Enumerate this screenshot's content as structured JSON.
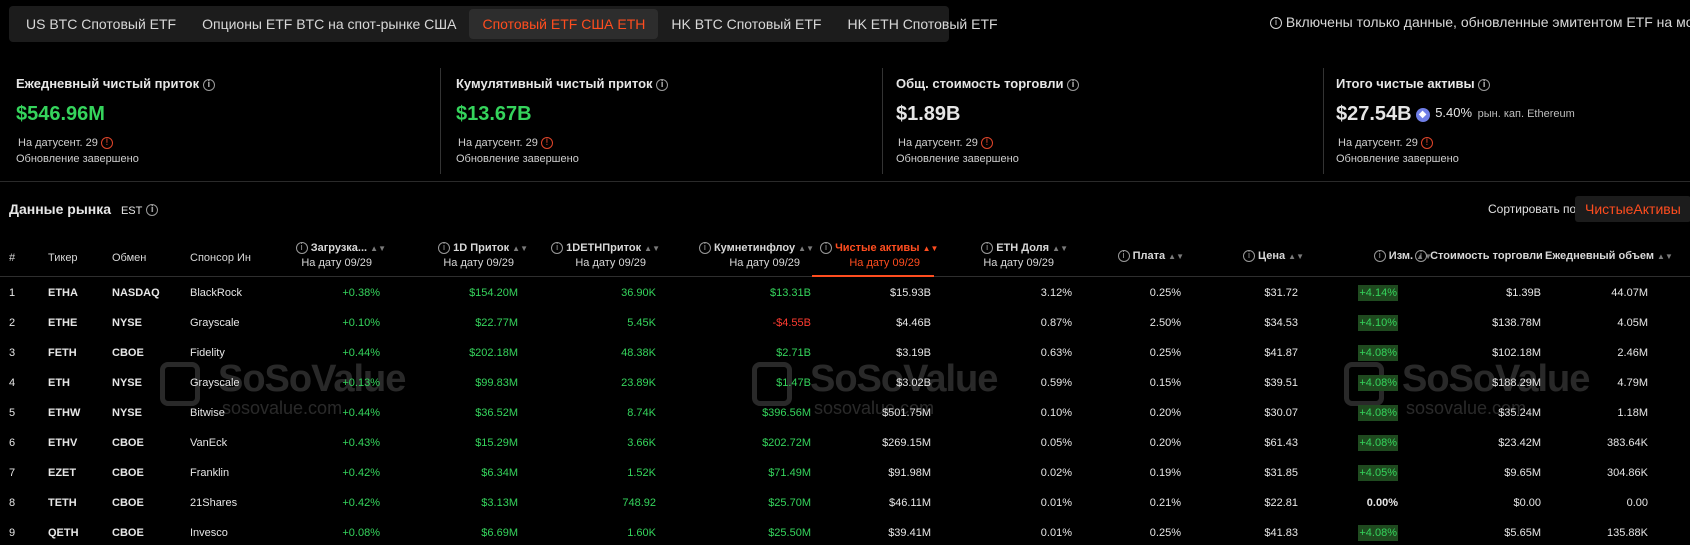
{
  "tabs": [
    {
      "label": "US BTC Спотовый ETF",
      "active": false
    },
    {
      "label": "Опционы ETF BTC на спот-рынке США",
      "active": false
    },
    {
      "label": "Спотовый ETF США ETH",
      "active": true
    },
    {
      "label": "HK BTC Спотовый ETF",
      "active": false
    },
    {
      "label": "HK ETH Спотовый ETF",
      "active": false
    }
  ],
  "notice": "Включены только данные, обновленные эмитентом ETF на момент",
  "cards": [
    {
      "label": "Ежедневный чистый приток",
      "value": "$546.96M",
      "date": "На датусент. 29",
      "status": "Обновление завершено"
    },
    {
      "label": "Кумулятивный чистый приток",
      "value": "$13.67B",
      "date": "На датусент. 29",
      "status": "Обновление завершено"
    },
    {
      "label": "Общ. стоимость торговли",
      "value": "$1.89B",
      "date": "На датусент. 29",
      "status": "Обновление завершено"
    },
    {
      "label": "Итого чистые активы",
      "value": "$27.54B",
      "pct": "5.40%",
      "sub": "рын. кап. Ethereum",
      "date": "На датусент. 29",
      "status": "Обновление завершено"
    }
  ],
  "market": {
    "title": "Данные рынка",
    "tz": "EST",
    "sort_label": "Сортировать по",
    "sort_value": "ЧистыеАктивы"
  },
  "headers": {
    "num": "#",
    "ticker": "Тикер",
    "exchange": "Обмен",
    "sponsor": "Спонсор Ин",
    "premium": {
      "l1": "Загрузка...",
      "l2": "На дату 09/29"
    },
    "inflow": {
      "l1": "1D Приток",
      "l2": "На дату 09/29"
    },
    "eth_inflow": {
      "l1": "1DETHПриток",
      "l2": "На дату 09/29"
    },
    "cum_inflow": {
      "l1": "Кумнетинфлоу",
      "l2": "На дату 09/29"
    },
    "net_assets": {
      "l1": "Чистые активы",
      "l2": "На дату 09/29"
    },
    "eth_share": {
      "l1": "ETH Доля",
      "l2": "На дату 09/29"
    },
    "fee": "Плата",
    "price": "Цена",
    "change": "Изм.",
    "value_traded": "Стоимость торговли",
    "volume": "Ежедневный объем"
  },
  "rows": [
    {
      "num": "1",
      "ticker": "ETHA",
      "exchange": "NASDAQ",
      "sponsor": "BlackRock",
      "premium": "+0.38%",
      "inflow": "$154.20M",
      "eth_inflow": "36.90K",
      "cum_inflow": "$13.31B",
      "net_assets": "$15.93B",
      "eth_share": "3.12%",
      "fee": "0.25%",
      "price": "$31.72",
      "change": "+4.14%",
      "value_traded": "$1.39B",
      "volume": "44.07M"
    },
    {
      "num": "2",
      "ticker": "ETHE",
      "exchange": "NYSE",
      "sponsor": "Grayscale",
      "premium": "+0.10%",
      "inflow": "$22.77M",
      "eth_inflow": "5.45K",
      "cum_inflow": "-$4.55B",
      "net_assets": "$4.46B",
      "eth_share": "0.87%",
      "fee": "2.50%",
      "price": "$34.53",
      "change": "+4.10%",
      "value_traded": "$138.78M",
      "volume": "4.05M"
    },
    {
      "num": "3",
      "ticker": "FETH",
      "exchange": "CBOE",
      "sponsor": "Fidelity",
      "premium": "+0.44%",
      "inflow": "$202.18M",
      "eth_inflow": "48.38K",
      "cum_inflow": "$2.71B",
      "net_assets": "$3.19B",
      "eth_share": "0.63%",
      "fee": "0.25%",
      "price": "$41.87",
      "change": "+4.08%",
      "value_traded": "$102.18M",
      "volume": "2.46M"
    },
    {
      "num": "4",
      "ticker": "ETH",
      "exchange": "NYSE",
      "sponsor": "Grayscale",
      "premium": "+0.13%",
      "inflow": "$99.83M",
      "eth_inflow": "23.89K",
      "cum_inflow": "$1.47B",
      "net_assets": "$3.02B",
      "eth_share": "0.59%",
      "fee": "0.15%",
      "price": "$39.51",
      "change": "+4.08%",
      "value_traded": "$188.29M",
      "volume": "4.79M"
    },
    {
      "num": "5",
      "ticker": "ETHW",
      "exchange": "NYSE",
      "sponsor": "Bitwise",
      "premium": "+0.44%",
      "inflow": "$36.52M",
      "eth_inflow": "8.74K",
      "cum_inflow": "$396.56M",
      "net_assets": "$501.75M",
      "eth_share": "0.10%",
      "fee": "0.20%",
      "price": "$30.07",
      "change": "+4.08%",
      "value_traded": "$35.24M",
      "volume": "1.18M"
    },
    {
      "num": "6",
      "ticker": "ETHV",
      "exchange": "CBOE",
      "sponsor": "VanEck",
      "premium": "+0.43%",
      "inflow": "$15.29M",
      "eth_inflow": "3.66K",
      "cum_inflow": "$202.72M",
      "net_assets": "$269.15M",
      "eth_share": "0.05%",
      "fee": "0.20%",
      "price": "$61.43",
      "change": "+4.08%",
      "value_traded": "$23.42M",
      "volume": "383.64K"
    },
    {
      "num": "7",
      "ticker": "EZET",
      "exchange": "CBOE",
      "sponsor": "Franklin",
      "premium": "+0.42%",
      "inflow": "$6.34M",
      "eth_inflow": "1.52K",
      "cum_inflow": "$71.49M",
      "net_assets": "$91.98M",
      "eth_share": "0.02%",
      "fee": "0.19%",
      "price": "$31.85",
      "change": "+4.05%",
      "value_traded": "$9.65M",
      "volume": "304.86K"
    },
    {
      "num": "8",
      "ticker": "TETH",
      "exchange": "CBOE",
      "sponsor": "21Shares",
      "premium": "+0.42%",
      "inflow": "$3.13M",
      "eth_inflow": "748.92",
      "cum_inflow": "$25.70M",
      "net_assets": "$46.11M",
      "eth_share": "0.01%",
      "fee": "0.21%",
      "price": "$22.81",
      "change": "0.00%",
      "value_traded": "$0.00",
      "volume": "0.00"
    },
    {
      "num": "9",
      "ticker": "QETH",
      "exchange": "CBOE",
      "sponsor": "Invesco",
      "premium": "+0.08%",
      "inflow": "$6.69M",
      "eth_inflow": "1.60K",
      "cum_inflow": "$25.50M",
      "net_assets": "$39.41M",
      "eth_share": "0.01%",
      "fee": "0.25%",
      "price": "$41.83",
      "change": "+4.08%",
      "value_traded": "$5.65M",
      "volume": "135.88K"
    }
  ],
  "watermark": {
    "brand": "SoSoValue",
    "domain": "sosovalue.com"
  },
  "colors": {
    "accent": "#ff4d1f",
    "positive": "#35d45c",
    "negative": "#ff3b30",
    "eth": "#6f7ee6"
  }
}
